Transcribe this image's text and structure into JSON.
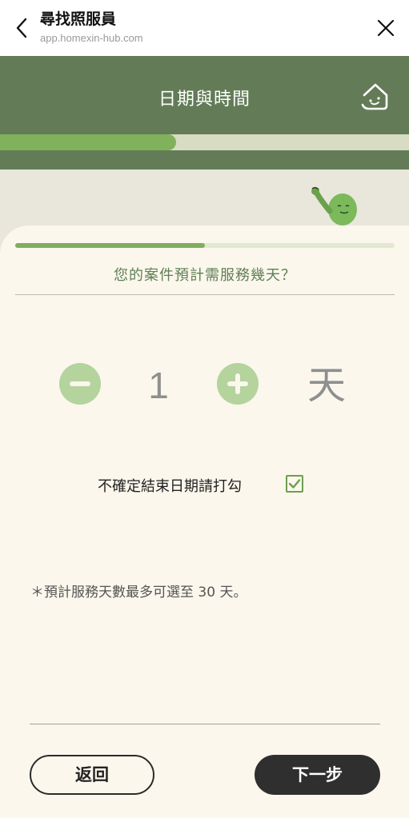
{
  "browser": {
    "title": "尋找照服員",
    "url": "app.homexin-hub.com",
    "back_icon": "chevron-left-icon",
    "close_icon": "close-icon"
  },
  "header": {
    "title": "日期與時間",
    "home_icon": "home-chat-icon",
    "progress": 0.43,
    "bg_color": "#637c57",
    "progress_color": "#80b25c"
  },
  "card": {
    "step_progress": 0.5,
    "question": "您的案件預計需服務幾天？",
    "stepper": {
      "minus_icon": "minus-circle-icon",
      "plus_icon": "plus-circle-icon",
      "value": "1",
      "unit": "天"
    },
    "uncertain": {
      "label": "不確定結束日期請打勾",
      "checked": true
    },
    "note": "＊預計服務天數最多可選至 30 天。"
  },
  "footer": {
    "back_label": "返回",
    "next_label": "下一步"
  }
}
